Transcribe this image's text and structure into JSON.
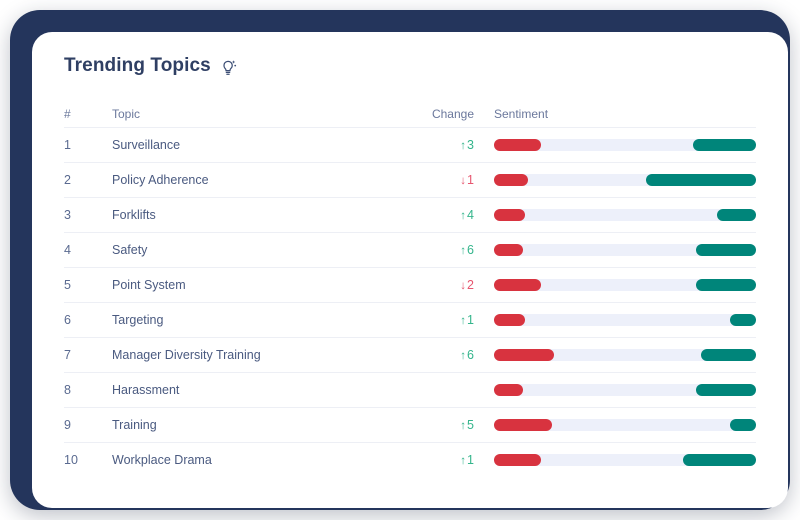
{
  "colors": {
    "frame": "#24355c",
    "card": "#ffffff",
    "title": "#2f3f63",
    "text": "#4a5a80",
    "divider": "#edeff5",
    "track": "#edf0fa",
    "negative": "#d8333f",
    "positive": "#00857a",
    "change_up": "#34b58c",
    "change_down": "#e7566f"
  },
  "header": {
    "title": "Trending Topics",
    "icon": "lightbulb-sparkle-icon"
  },
  "table": {
    "columns": {
      "rank": "#",
      "topic": "Topic",
      "change": "Change",
      "sentiment": "Sentiment"
    },
    "rows": [
      {
        "rank": "1",
        "topic": "Surveillance",
        "change_arrow": "↑",
        "change_value": "3",
        "change_direction": "up",
        "negative_pct": 18,
        "positive_pct": 24
      },
      {
        "rank": "2",
        "topic": "Policy Adherence",
        "change_arrow": "↓",
        "change_value": "1",
        "change_direction": "down",
        "negative_pct": 13,
        "positive_pct": 42
      },
      {
        "rank": "3",
        "topic": "Forklifts",
        "change_arrow": "↑",
        "change_value": "4",
        "change_direction": "up",
        "negative_pct": 12,
        "positive_pct": 15
      },
      {
        "rank": "4",
        "topic": "Safety",
        "change_arrow": "↑",
        "change_value": "6",
        "change_direction": "up",
        "negative_pct": 11,
        "positive_pct": 23
      },
      {
        "rank": "5",
        "topic": "Point System",
        "change_arrow": "↓",
        "change_value": "2",
        "change_direction": "down",
        "negative_pct": 18,
        "positive_pct": 23
      },
      {
        "rank": "6",
        "topic": "Targeting",
        "change_arrow": "↑",
        "change_value": "1",
        "change_direction": "up",
        "negative_pct": 12,
        "positive_pct": 10
      },
      {
        "rank": "7",
        "topic": "Manager Diversity Training",
        "change_arrow": "↑",
        "change_value": "6",
        "change_direction": "up",
        "negative_pct": 23,
        "positive_pct": 21
      },
      {
        "rank": "8",
        "topic": "Harassment",
        "change_arrow": "",
        "change_value": "",
        "change_direction": "none",
        "negative_pct": 11,
        "positive_pct": 23
      },
      {
        "rank": "9",
        "topic": "Training",
        "change_arrow": "↑",
        "change_value": "5",
        "change_direction": "up",
        "negative_pct": 22,
        "positive_pct": 10
      },
      {
        "rank": "10",
        "topic": "Workplace Drama",
        "change_arrow": "↑",
        "change_value": "1",
        "change_direction": "up",
        "negative_pct": 18,
        "positive_pct": 28
      }
    ]
  }
}
